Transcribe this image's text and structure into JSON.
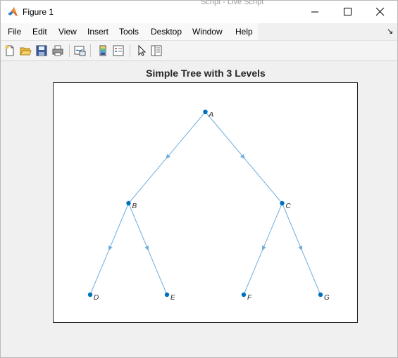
{
  "window": {
    "title": "Figure 1",
    "behind_text": "Script - Live Script"
  },
  "menu": [
    "File",
    "Edit",
    "View",
    "Insert",
    "Tools",
    "Desktop",
    "Window",
    "Help"
  ],
  "menu_overflow": "↘",
  "toolbar": {
    "icons": [
      "new-figure-icon",
      "open-file-icon",
      "save-icon",
      "print-icon",
      "link-plot-icon",
      "insert-colorbar-icon",
      "insert-legend-icon",
      "edit-plot-arrow-icon",
      "property-inspector-icon"
    ]
  },
  "chart_data": {
    "type": "graph",
    "title": "Simple Tree with 3 Levels",
    "nodes": [
      "A",
      "B",
      "C",
      "D",
      "E",
      "F",
      "G"
    ],
    "edges": [
      [
        "A",
        "B"
      ],
      [
        "A",
        "C"
      ],
      [
        "B",
        "D"
      ],
      [
        "B",
        "E"
      ],
      [
        "C",
        "F"
      ],
      [
        "C",
        "G"
      ]
    ],
    "layout": "layered",
    "node_color": "#0072BD",
    "edge_color": "#6FAEDC",
    "directed": true
  }
}
